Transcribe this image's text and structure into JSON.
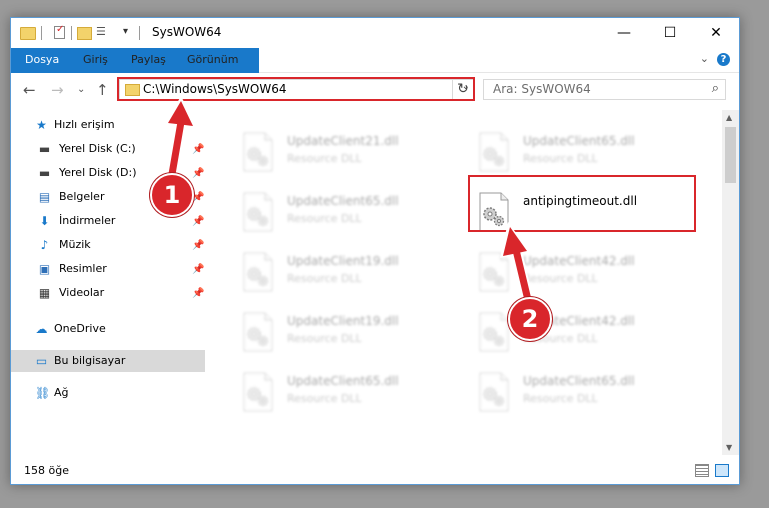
{
  "window": {
    "title": "SysWOW64",
    "controls": {
      "minimize": "—",
      "maximize": "☐",
      "close": "✕"
    },
    "quick_access_dropdown": "▾"
  },
  "ribbon": {
    "tabs": [
      "Dosya",
      "Giriş",
      "Paylaş",
      "Görünüm"
    ],
    "expand": "⌄",
    "help": "?"
  },
  "nav": {
    "back": "←",
    "forward": "→",
    "recent": "⌄",
    "up": "↑",
    "address": "C:\\Windows\\SysWOW64",
    "address_dropdown": "⌄",
    "refresh": "↻",
    "search_placeholder": "Ara: SysWOW64",
    "search_icon": "⌕"
  },
  "sidebar": {
    "quick_access": "Hızlı erişim",
    "items": [
      {
        "label": "Yerel Disk (C:)",
        "icon": "drive-icon",
        "glyph": "▬",
        "pinned": true
      },
      {
        "label": "Yerel Disk (D:)",
        "icon": "drive-icon",
        "glyph": "▬",
        "pinned": true
      },
      {
        "label": "Belgeler",
        "icon": "documents-icon",
        "glyph": "▤",
        "pinned": true
      },
      {
        "label": "İndirmeler",
        "icon": "downloads-icon",
        "glyph": "⬇",
        "pinned": true
      },
      {
        "label": "Müzik",
        "icon": "music-icon",
        "glyph": "♪",
        "pinned": true
      },
      {
        "label": "Resimler",
        "icon": "pictures-icon",
        "glyph": "▣",
        "pinned": true
      },
      {
        "label": "Videolar",
        "icon": "videos-icon",
        "glyph": "▦",
        "pinned": true
      }
    ],
    "pin_glyph": "📌",
    "onedrive": "OneDrive",
    "this_pc": "Bu bilgisayar",
    "network": "Ağ"
  },
  "files": {
    "left_column": [
      {
        "name": "UpdateClient21.dll",
        "type": "Resource DLL"
      },
      {
        "name": "UpdateClient65.dll",
        "type": "Resource DLL"
      },
      {
        "name": "UpdateClient19.dll",
        "type": "Resource DLL"
      },
      {
        "name": "UpdateClient19.dll",
        "type": "Resource DLL"
      },
      {
        "name": "UpdateClient65.dll",
        "type": "Resource DLL"
      }
    ],
    "right_column": [
      {
        "name": "UpdateClient65.dll",
        "type": "Resource DLL"
      },
      {
        "name": "antipingtimeout.dll",
        "type": ""
      },
      {
        "name": "UpdateClient42.dll",
        "type": "Resource DLL"
      },
      {
        "name": "UpdateClient42.dll",
        "type": "Resource DLL"
      },
      {
        "name": "UpdateClient65.dll",
        "type": "Resource DLL"
      }
    ],
    "highlighted": "antipingtimeout.dll"
  },
  "status": {
    "item_count": "158 öğe"
  },
  "callouts": [
    "1",
    "2"
  ],
  "colors": {
    "accent": "#1979ca",
    "highlight_red": "#d9262b",
    "folder_yellow": "#f3d36b"
  }
}
